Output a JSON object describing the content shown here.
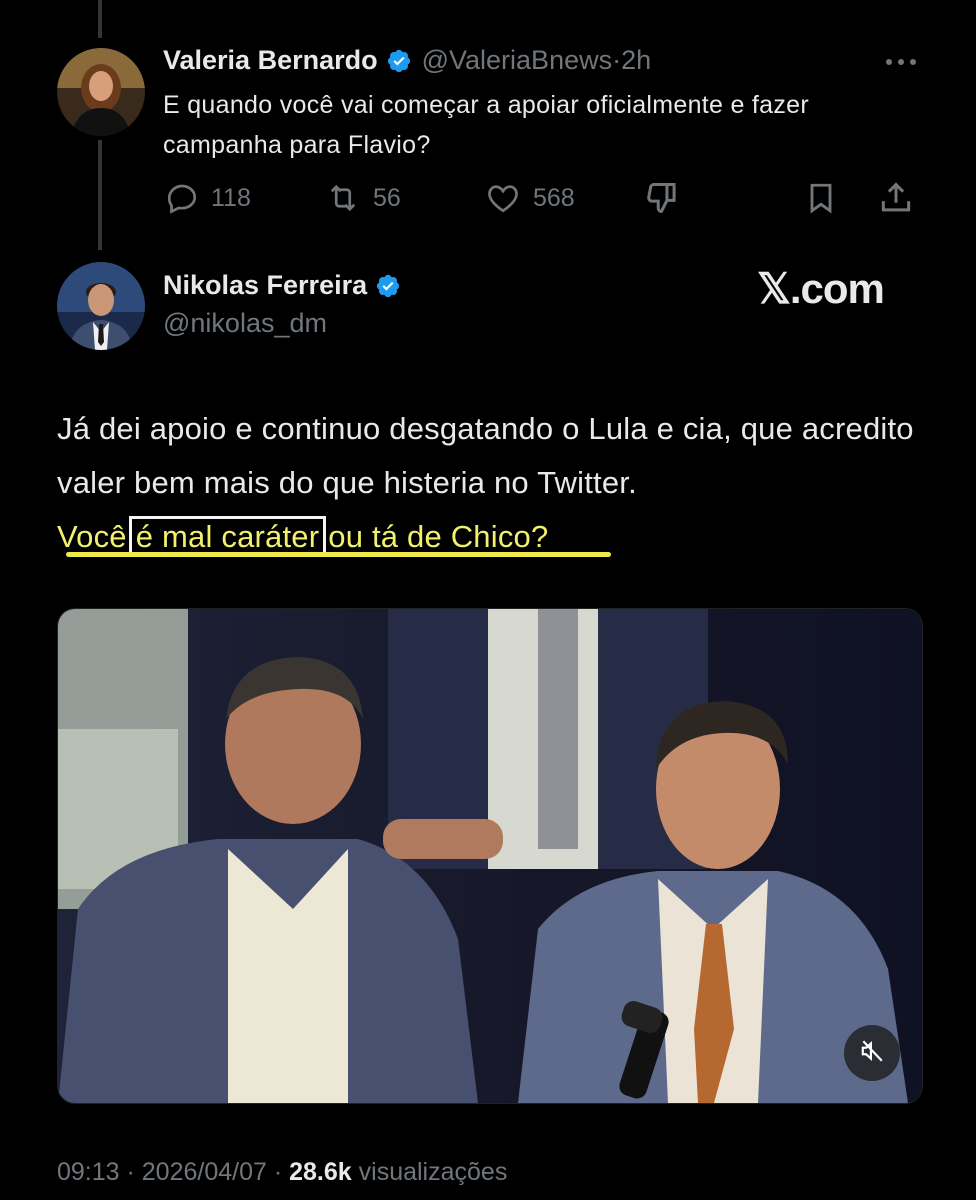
{
  "reply_tweet": {
    "author_name": "Valeria Bernardo",
    "author_handle": "@ValeriaBnews",
    "separator": " · ",
    "time_ago": "2h",
    "text": "E quando você vai começar a apoiar oficialmente e fazer campanha para Flavio?",
    "stats": {
      "replies": "118",
      "reposts": "56",
      "likes": "568"
    },
    "icons": [
      "reply-icon",
      "repost-icon",
      "like-icon",
      "dislike-icon",
      "bookmark-icon",
      "share-icon",
      "more-icon"
    ]
  },
  "main_tweet": {
    "author_name": "Nikolas Ferreira",
    "author_handle": "@nikolas_dm",
    "text_part1": "Já dei apoio e continuo desgatando o Lula e cia, que acredito valer bem mais do que histeria no Twitter.",
    "text_hl_before": "Você",
    "text_hl_boxed": "é mal caráter",
    "text_hl_after": "ou tá de Chico?",
    "meta_time": "09:13",
    "meta_sep": " · ",
    "meta_date": "2026/04/07",
    "meta_views_count": "28.6k",
    "meta_views_label": "visualizações"
  },
  "brand": {
    "logo_letter": "𝕏",
    "domain_text": ".com"
  },
  "colors": {
    "background": "#000000",
    "text": "#e7e9ea",
    "muted": "#71767b",
    "verified": "#1d9bf0",
    "highlight": "#f3f06b"
  }
}
